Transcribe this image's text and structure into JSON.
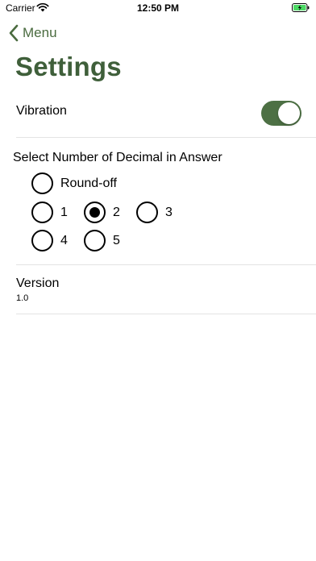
{
  "status_bar": {
    "carrier": "Carrier",
    "time": "12:50 PM",
    "wifi_icon": "wifi-icon",
    "battery_icon": "battery-charging-icon"
  },
  "nav": {
    "back_label": "Menu",
    "back_icon": "chevron-left-icon"
  },
  "page": {
    "title": "Settings"
  },
  "vibration": {
    "label": "Vibration",
    "enabled": true
  },
  "decimal": {
    "heading": "Select Number of Decimal in Answer",
    "options": [
      {
        "label": "Round-off",
        "selected": false
      },
      {
        "label": "1",
        "selected": false
      },
      {
        "label": "2",
        "selected": true
      },
      {
        "label": "3",
        "selected": false
      },
      {
        "label": "4",
        "selected": false
      },
      {
        "label": "5",
        "selected": false
      }
    ]
  },
  "version": {
    "label": "Version",
    "value": "1.0"
  },
  "colors": {
    "accent": "#4d7044",
    "title": "#3f5f3a",
    "divider": "#e3e3e3",
    "battery": "#4cd964"
  }
}
